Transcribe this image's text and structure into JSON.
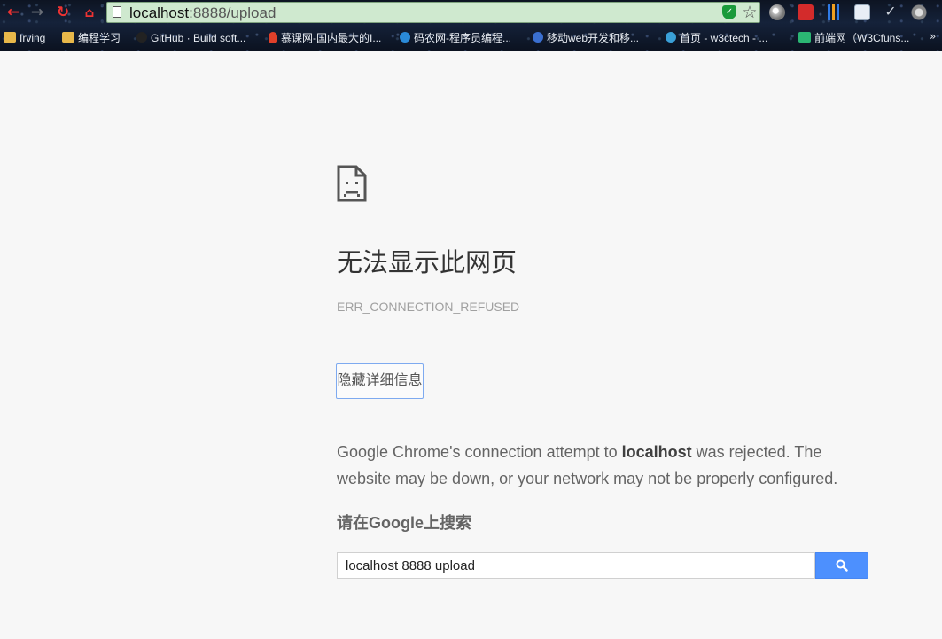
{
  "browser": {
    "address_bar": {
      "host": "localhost",
      "path": ":8888/upload"
    },
    "icons": {
      "back": "back-arrow-icon",
      "forward": "forward-arrow-icon",
      "reload": "reload-icon",
      "home": "home-icon",
      "shield": "shield-icon",
      "star": "bookmark-star-icon"
    },
    "bookmarks": [
      {
        "label": "Irving",
        "icon": "folder-icon"
      },
      {
        "label": "编程学习",
        "icon": "folder-icon"
      },
      {
        "label": "GitHub · Build soft...",
        "icon": "github-icon"
      },
      {
        "label": "慕课网-国内最大的I...",
        "icon": "imooc-icon"
      },
      {
        "label": "码农网-程序员编程...",
        "icon": "codeceo-icon"
      },
      {
        "label": "移动web开发和移...",
        "icon": "mobile-web-icon"
      },
      {
        "label": "首页 - w3ctech - ...",
        "icon": "w3ctech-icon"
      },
      {
        "label": "前端网（W3Cfuns...",
        "icon": "w3cfuns-icon"
      }
    ],
    "bookmarks_more": "»"
  },
  "error_page": {
    "title": "无法显示此网页",
    "error_code": "ERR_CONNECTION_REFUSED",
    "details_button_label": "隐藏详细信息",
    "description_prefix": "Google Chrome's connection attempt to ",
    "description_host": "localhost",
    "description_suffix": " was rejected. The website may be down, or your network may not be properly configured.",
    "search_heading": "请在Google上搜索",
    "search_value": "localhost 8888 upload"
  },
  "colors": {
    "page_background": "#f7f7f7",
    "omnibox_background": "#cfe9cf",
    "search_button": "#4d90fe",
    "details_border": "#7eaaf0"
  }
}
